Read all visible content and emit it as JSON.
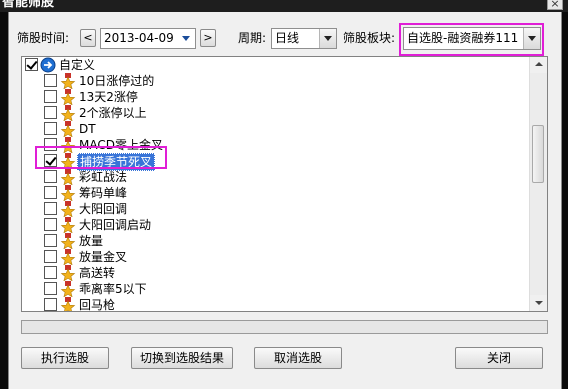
{
  "window": {
    "title": "智能筛股",
    "close_symbol": "×"
  },
  "filter": {
    "date_label": "筛股时间:",
    "prev_symbol": "<",
    "date_value": "2013-04-09",
    "next_symbol": ">",
    "period_label": "周期:",
    "period_value": "日线",
    "sector_label": "筛股板块:",
    "sector_value": "自选股-融资融券111"
  },
  "tree": {
    "root": {
      "label": "自定义",
      "checked": true,
      "icon": "blue-circle-arrow-icon"
    },
    "items": [
      {
        "label": "10日涨停过的",
        "checked": false
      },
      {
        "label": "13天2涨停",
        "checked": false
      },
      {
        "label": "2个涨停以上",
        "checked": false
      },
      {
        "label": "DT",
        "checked": false
      },
      {
        "label": "MACD零上金叉",
        "checked": false
      },
      {
        "label": "捕捞季节死叉",
        "checked": true,
        "selected": true
      },
      {
        "label": "彩虹战法",
        "checked": false
      },
      {
        "label": "筹码单峰",
        "checked": false
      },
      {
        "label": "大阳回调",
        "checked": false
      },
      {
        "label": "大阳回调启动",
        "checked": false
      },
      {
        "label": "放量",
        "checked": false
      },
      {
        "label": "放量金叉",
        "checked": false
      },
      {
        "label": "高送转",
        "checked": false
      },
      {
        "label": "乖离率5以下",
        "checked": false
      },
      {
        "label": "回马枪",
        "checked": false
      }
    ],
    "item_icon": "gold-star-icon"
  },
  "progress": {
    "value": 0
  },
  "buttons": {
    "execute": "执行选股",
    "switch": "切换到选股结果",
    "cancel": "取消选股",
    "close": "关闭"
  },
  "colors": {
    "highlight": "#e01ed6",
    "selection": "#3874d8",
    "dialog_bg": "#f0f0f0"
  }
}
